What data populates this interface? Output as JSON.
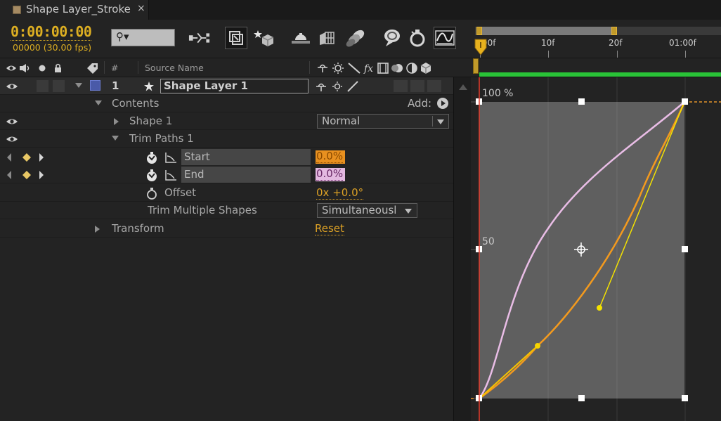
{
  "tab": {
    "title": "Shape Layer_Stroke",
    "close": "×",
    "swatch_color": "#a58a62"
  },
  "toolbar": {
    "timecode": "0:00:00:00",
    "fps": "00000 (30.00 fps)",
    "search_glyph": "⚲▾",
    "icons": [
      "composition-flowchart-icon",
      "draft-3d-icon",
      "shy-layers-icon",
      "frame-blending-icon",
      "motion-blur-icon",
      "brainstorm-icon",
      "auto-keyframe-icon",
      "graph-editor-icon"
    ]
  },
  "ruler": {
    "ticks": [
      "00f",
      "10f",
      "20f",
      "01:00f"
    ]
  },
  "columns": {
    "number": "#",
    "source_name": "Source Name"
  },
  "layer": {
    "number": "1",
    "name": "Shape Layer 1",
    "label_color": "#4a5aa8"
  },
  "rows": {
    "contents": "Contents",
    "add": "Add:",
    "shape1": "Shape 1",
    "blend_mode": "Normal",
    "trim_paths": "Trim Paths 1",
    "start_label": "Start",
    "start_value": "0.0%",
    "end_label": "End",
    "end_value": "0.0%",
    "offset_label": "Offset",
    "offset_value": "0x +0.0°",
    "trim_multiple_label": "Trim Multiple Shapes",
    "trim_multiple_value": "Simultaneousl",
    "transform": "Transform",
    "reset": "Reset"
  },
  "graph": {
    "label_top": "100 %",
    "label_mid": "50",
    "colors": {
      "start_curve": "#f39a1e",
      "end_curve": "#e9bde6",
      "handle": "#f5e200",
      "time_indicator": "#e53a2a",
      "bounding_box": "#5f5f5f"
    }
  }
}
